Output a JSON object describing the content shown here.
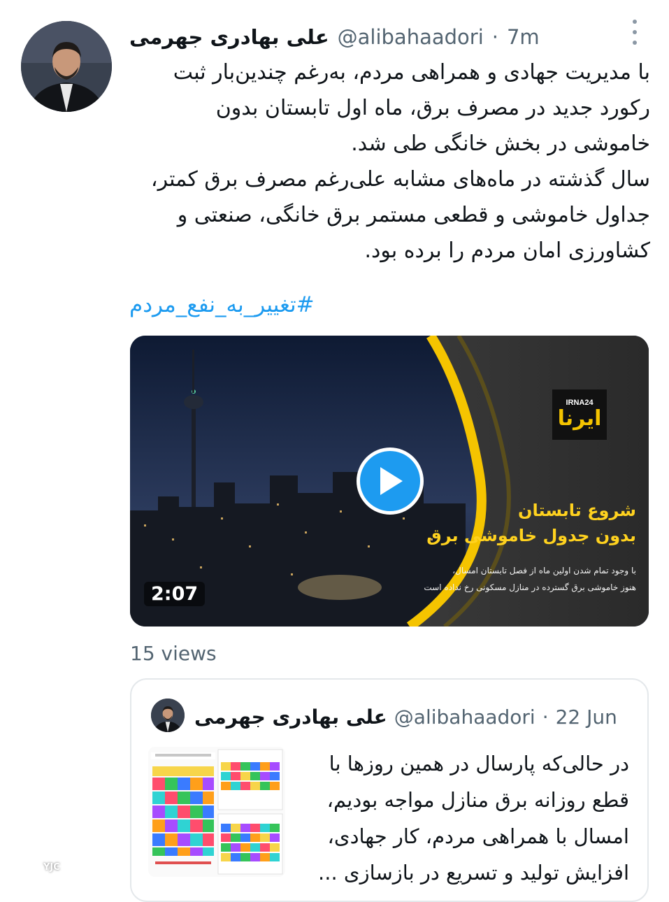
{
  "author": {
    "name": "علی بهادری جهرمی",
    "handle": "@alibahaadori",
    "separator": "·",
    "time": "7m"
  },
  "tweet": {
    "text": "با مدیریت جهادی و همراهی مردم، به‌رغم چندین‌بار ثبت\nرکورد جدید در مصرف برق، ماه اول تابستان بدون\nخاموشی در بخش خانگی طی شد.\nسال گذشته در ماه‌های مشابه علی‌رغم مصرف برق کمتر،\nجداول خاموشی و قطعی مستمر برق خانگی، صنعتی و\nکشاورزی امان مردم را برده بود.",
    "hashtag": "#تغییر_به_نفع_مردم"
  },
  "media": {
    "duration": "2:07",
    "logo_top": "IRNA24",
    "logo_main": "ایرنا",
    "overlay_title_1": "شروع تابستان",
    "overlay_title_2": "بدون جدول خاموشی برق",
    "overlay_caption_1": "با وجود تمام شدن اولین ماه از فصل تابستان امسال،",
    "overlay_caption_2": "هنوز خاموشی برق گسترده در منازل مسکونی رخ نداده است",
    "play_icon": "play-icon"
  },
  "stats": {
    "views": "15 views"
  },
  "quoted": {
    "name": "علی بهادری جهرمی",
    "handle": "@alibahaadori",
    "separator": "·",
    "date": "22 Jun",
    "text": "در حالی‌که پارسال در همین روزها با\nقطع روزانه برق منازل مواجه بودیم،\nامسال با همراهی مردم، کار جهادی،\nافزایش تولید و تسریع در بازسازی ..."
  },
  "watermark": {
    "text": "YJC"
  },
  "colors": {
    "accent": "#1d9bf0",
    "secondary_text": "#536471",
    "overlay_yellow": "#ffd21f"
  }
}
